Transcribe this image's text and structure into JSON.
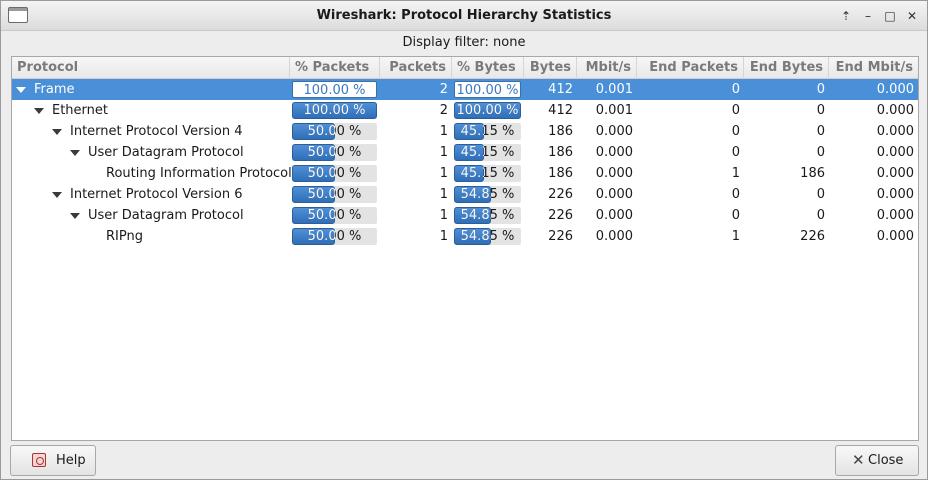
{
  "window": {
    "title": "Wireshark: Protocol Hierarchy Statistics"
  },
  "filter_text": "Display filter: none",
  "columns": [
    "Protocol",
    "% Packets",
    "Packets",
    "% Bytes",
    "Bytes",
    "Mbit/s",
    "End Packets",
    "End Bytes",
    "End Mbit/s"
  ],
  "rows": [
    {
      "protocol": "Frame",
      "pct_packets": "100.00 %",
      "pct_packets_value": 100.0,
      "packets": "2",
      "pct_bytes": "100.00 %",
      "pct_bytes_value": 100.0,
      "bytes": "412",
      "mbit": "0.001",
      "end_packets": "0",
      "end_bytes": "0",
      "end_mbit": "0.000",
      "level": 0,
      "expanded": true,
      "selected": true
    },
    {
      "protocol": "Ethernet",
      "pct_packets": "100.00 %",
      "pct_packets_value": 100.0,
      "packets": "2",
      "pct_bytes": "100.00 %",
      "pct_bytes_value": 100.0,
      "bytes": "412",
      "mbit": "0.001",
      "end_packets": "0",
      "end_bytes": "0",
      "end_mbit": "0.000",
      "level": 1,
      "expanded": true,
      "selected": false
    },
    {
      "protocol": "Internet Protocol Version 4",
      "pct_packets": "50.00 %",
      "pct_packets_value": 50.0,
      "packets": "1",
      "pct_bytes": "45.15 %",
      "pct_bytes_value": 45.15,
      "bytes": "186",
      "mbit": "0.000",
      "end_packets": "0",
      "end_bytes": "0",
      "end_mbit": "0.000",
      "level": 2,
      "expanded": true,
      "selected": false
    },
    {
      "protocol": "User Datagram Protocol",
      "pct_packets": "50.00 %",
      "pct_packets_value": 50.0,
      "packets": "1",
      "pct_bytes": "45.15 %",
      "pct_bytes_value": 45.15,
      "bytes": "186",
      "mbit": "0.000",
      "end_packets": "0",
      "end_bytes": "0",
      "end_mbit": "0.000",
      "level": 3,
      "expanded": true,
      "selected": false
    },
    {
      "protocol": "Routing Information Protocol",
      "pct_packets": "50.00 %",
      "pct_packets_value": 50.0,
      "packets": "1",
      "pct_bytes": "45.15 %",
      "pct_bytes_value": 45.15,
      "bytes": "186",
      "mbit": "0.000",
      "end_packets": "1",
      "end_bytes": "186",
      "end_mbit": "0.000",
      "level": 4,
      "expanded": false,
      "selected": false
    },
    {
      "protocol": "Internet Protocol Version 6",
      "pct_packets": "50.00 %",
      "pct_packets_value": 50.0,
      "packets": "1",
      "pct_bytes": "54.85 %",
      "pct_bytes_value": 54.85,
      "bytes": "226",
      "mbit": "0.000",
      "end_packets": "0",
      "end_bytes": "0",
      "end_mbit": "0.000",
      "level": 2,
      "expanded": true,
      "selected": false
    },
    {
      "protocol": "User Datagram Protocol",
      "pct_packets": "50.00 %",
      "pct_packets_value": 50.0,
      "packets": "1",
      "pct_bytes": "54.85 %",
      "pct_bytes_value": 54.85,
      "bytes": "226",
      "mbit": "0.000",
      "end_packets": "0",
      "end_bytes": "0",
      "end_mbit": "0.000",
      "level": 3,
      "expanded": true,
      "selected": false
    },
    {
      "protocol": "RIPng",
      "pct_packets": "50.00 %",
      "pct_packets_value": 50.0,
      "packets": "1",
      "pct_bytes": "54.85 %",
      "pct_bytes_value": 54.85,
      "bytes": "226",
      "mbit": "0.000",
      "end_packets": "1",
      "end_bytes": "226",
      "end_mbit": "0.000",
      "level": 4,
      "expanded": false,
      "selected": false
    }
  ],
  "buttons": {
    "help": "Help",
    "close": "Close"
  },
  "colors": {
    "selection": "#4a90d9",
    "bar": "#3a78c5"
  }
}
